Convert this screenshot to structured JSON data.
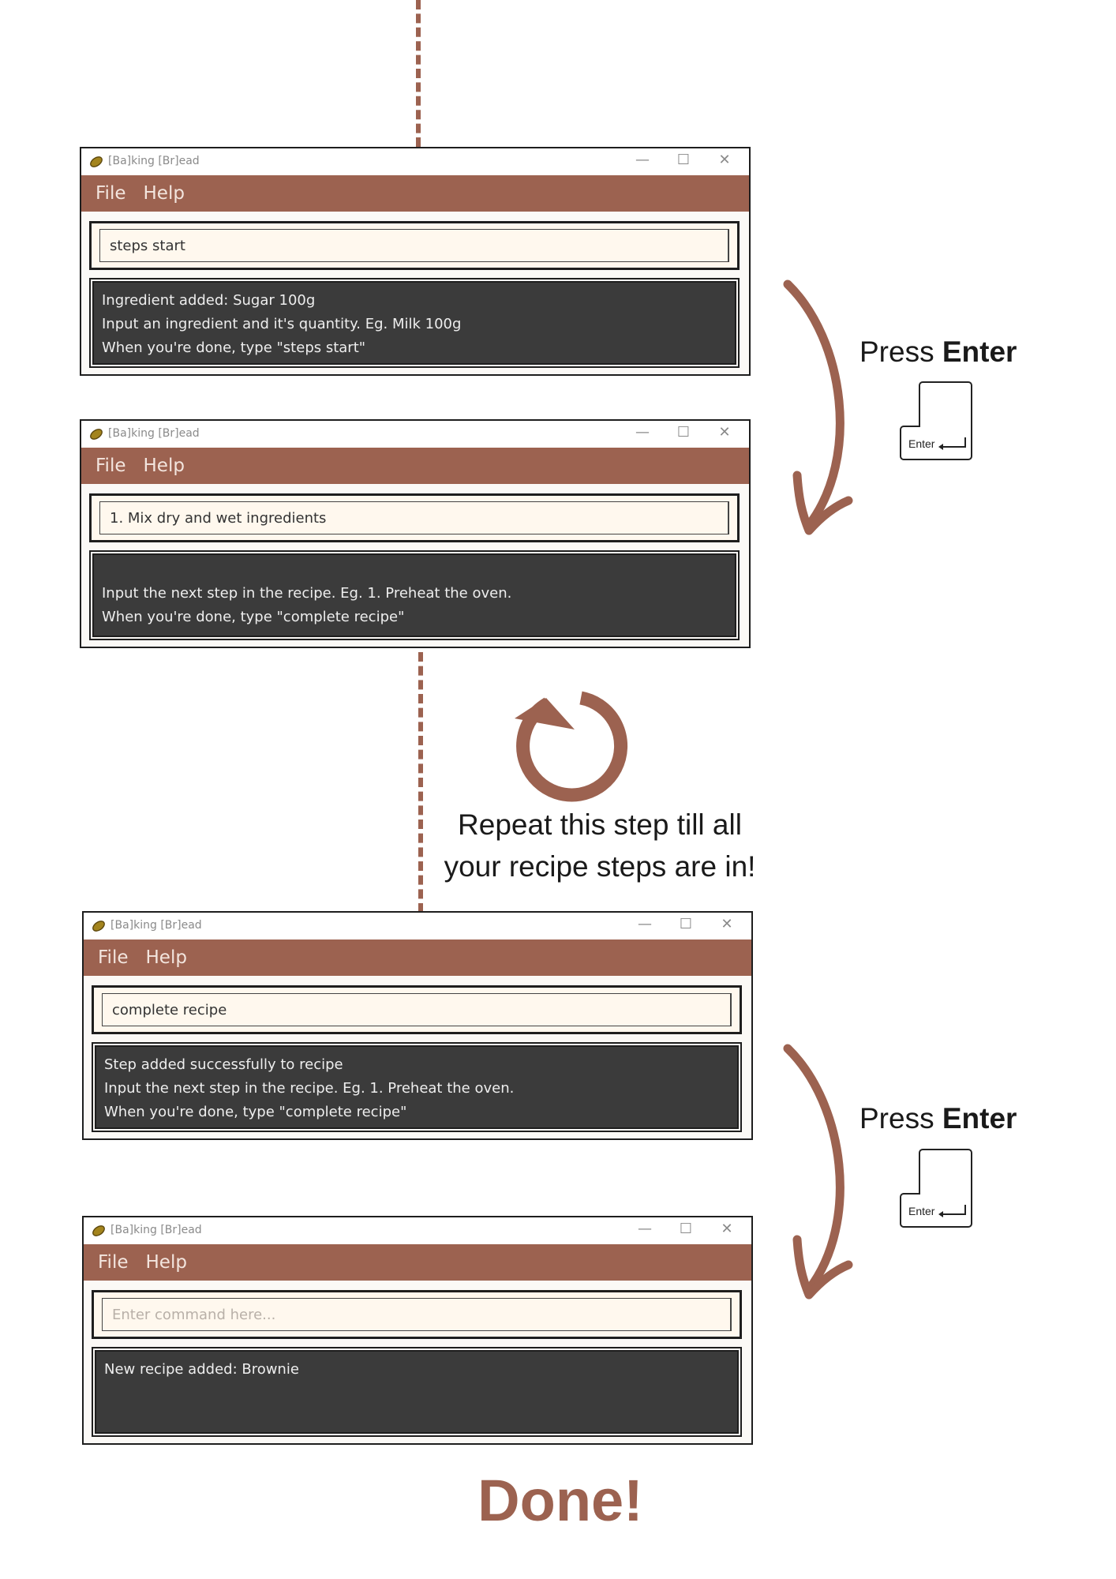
{
  "colors": {
    "accent": "#9c6250",
    "window_bg": "#fbf9f6",
    "result_bg": "#3b3b3b",
    "input_bg": "#fff8ee"
  },
  "windows": [
    {
      "title": "[Ba]king [Br]ead",
      "menu": [
        "File",
        "Help"
      ],
      "command": "steps start",
      "result_lines": [
        "Ingredient added: Sugar 100g",
        "Input an ingredient and it's quantity. Eg. Milk 100g",
        "When you're done, type \"steps start\""
      ]
    },
    {
      "title": "[Ba]king [Br]ead",
      "menu": [
        "File",
        "Help"
      ],
      "command": "1. Mix dry and wet ingredients",
      "result_lines": [
        "Input the next step in the recipe. Eg. 1. Preheat the oven.",
        "When you're done, type \"complete recipe\""
      ]
    },
    {
      "title": "[Ba]king [Br]ead",
      "menu": [
        "File",
        "Help"
      ],
      "command": "complete recipe",
      "result_lines": [
        "Step added successfully to recipe",
        "Input the next step in the recipe. Eg. 1. Preheat the oven.",
        "When you're done, type \"complete recipe\""
      ]
    },
    {
      "title": "[Ba]king [Br]ead",
      "menu": [
        "File",
        "Help"
      ],
      "command_placeholder": "Enter command here...",
      "result_lines": [
        "New recipe added: Brownie"
      ]
    }
  ],
  "press_prefix": "Press",
  "press_key": "Enter",
  "key_label": "Enter",
  "repeat_line1": "Repeat this step till all",
  "repeat_line2": "your recipe steps are in!",
  "done": "Done!",
  "icons": {
    "app": "bread-icon",
    "minimize": "minimize-icon",
    "maximize": "maximize-icon",
    "close": "close-icon",
    "repeat": "repeat-icon",
    "enter_key": "enter-key-icon",
    "return_arrow": "return-arrow-icon"
  }
}
